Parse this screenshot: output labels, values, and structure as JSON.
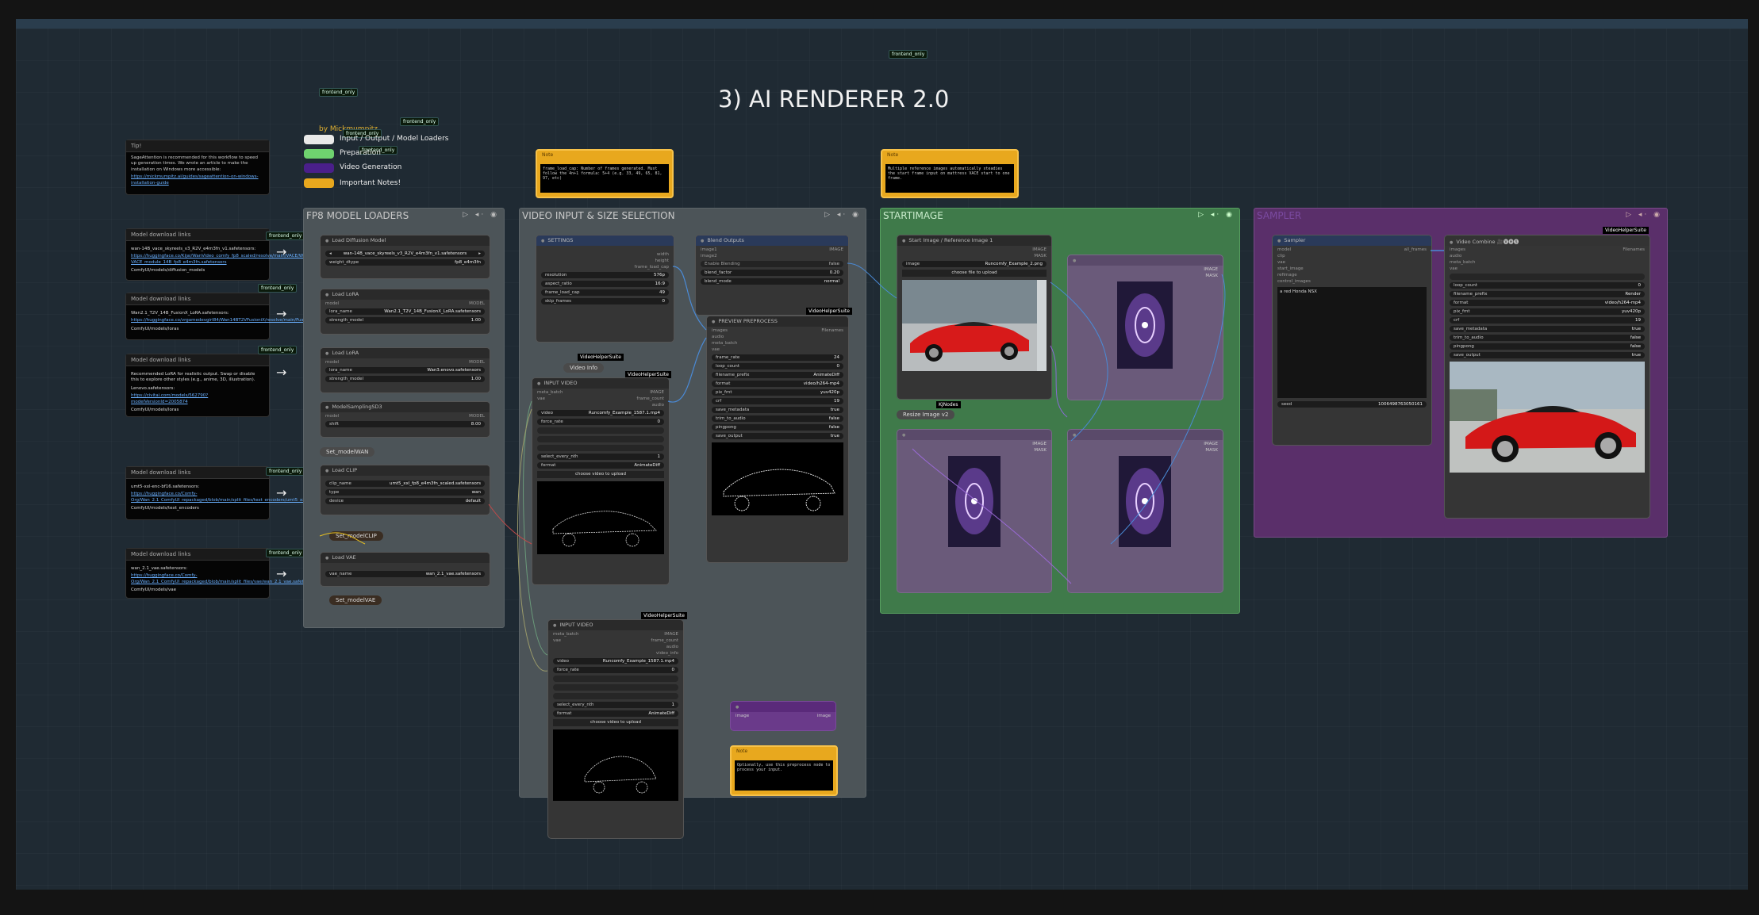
{
  "title": "3) AI RENDERER 2.0",
  "author": "by Mickmumpitz",
  "frontend_tag": "frontend_only",
  "legend": [
    {
      "label": "Input / Output / Model Loaders",
      "color": "#e9e9e9"
    },
    {
      "label": "Preparation",
      "color": "#6fd36f"
    },
    {
      "label": "Video Generation",
      "color": "#4a1f8a"
    },
    {
      "label": "Important Notes!",
      "color": "#e8a81e"
    }
  ],
  "tips": {
    "title": "Tip!",
    "body": "SageAttention is recommended for this workflow to speed up generation times. We wrote an article to make the installation on Windows more accessible:",
    "link": "https://mickmumpitz.ai/guides/sageattention-on-windows-installation-guide"
  },
  "downloads": [
    {
      "title": "Model download links",
      "name": "wan-14B_vace_skyreels_v3_R2V_e4m3fn_v1.safetensors:",
      "link": "https://huggingface.co/Kijai/WanVideo_comfy_fp8_scaled/resolve/main/VACE/Wan2_1-VACE_module_14B_fp8_e4m3fn.safetensors",
      "path": "ComfyUI/models/diffusion_models"
    },
    {
      "title": "Model download links",
      "name": "Wan2.1_T2V_14B_FusionX_LoRA.safetensors:",
      "link": "https://huggingface.co/vrgamedevgirl84/Wan14BT2VFusioniX/resolve/main/FusionX_LoRa/Wan2.1_T2V_14B_FusionX_LoRA.safetensors",
      "path": "ComfyUI/models/loras"
    },
    {
      "title": "Model download links",
      "name": "Recommended LoRA for realistic output. Swap or disable this to explore other styles (e.g., anime, 3D, illustration).",
      "link": "https://civitai.com/models/562790?modelVersionId=2005874",
      "path": "ComfyUI/models/loras",
      "extra": "Lenovo.safetensors:"
    },
    {
      "title": "Model download links",
      "name": "umt5-xxl-enc-bf16.safetensors:",
      "link": "https://huggingface.co/Comfy-Org/Wan_2.1_ComfyUI_repackaged/blob/main/split_files/text_encoders/umt5_xxl_fp8_e4m3fn_scaled.safetensors",
      "path": "ComfyUI/models/text_encoders"
    },
    {
      "title": "Model download links",
      "name": "wan_2.1_vae.safetensors:",
      "link": "https://huggingface.co/Comfy-Org/Wan_2.1_ComfyUI_repackaged/blob/main/split_files/vae/wan_2.1_vae.safetensors",
      "path": "ComfyUI/models/vae"
    }
  ],
  "groups": {
    "fp8": "FP8 MODEL LOADERS",
    "video": "VIDEO INPUT & SIZE SELECTION",
    "start": "STARTIMAGE",
    "sampler": "SAMPLER"
  },
  "loaders": {
    "diffusion": {
      "title": "Load Diffusion Model",
      "model": "wan-14B_vace_skyreels_v3_R2V_e4m3fn_v1.safetensors",
      "dtype_label": "weight_dtype",
      "dtype": "fp8_e4m3fn"
    },
    "lora1": {
      "title": "Load LoRA",
      "name_label": "lora_name",
      "name": "Wan2.1_T2V_14B_FusionX_LoRA.safetensors",
      "strength_label": "strength_model",
      "strength": "1.00"
    },
    "lora2": {
      "title": "Load LoRA",
      "name_label": "lora_name",
      "name": "Wan3.enovo.safetensors",
      "strength_label": "strength_model",
      "strength": "1.00"
    },
    "sampling": {
      "title": "ModelSamplingSD3",
      "shift_label": "shift",
      "shift": "8.00"
    },
    "set_wan": "Set_modelWAN",
    "clip": {
      "title": "Load CLIP",
      "name_label": "clip_name",
      "name": "umt5_xxl_fp8_e4m3fn_scaled.safetensors",
      "type_label": "type",
      "type": "wan",
      "device_label": "device",
      "device": "default"
    },
    "set_clip": "Set_modelCLIP",
    "vae": {
      "title": "Load VAE",
      "name_label": "vae_name",
      "name": "wan_2.1_vae.safetensors"
    },
    "set_vae": "Set_modelVAE"
  },
  "settings": {
    "title": "SETTINGS",
    "rows": [
      [
        "resolution",
        "576p"
      ],
      [
        "aspect_ratio",
        "16:9"
      ],
      [
        "frame_load_cap",
        "49"
      ],
      [
        "skip_frames",
        "0"
      ]
    ]
  },
  "video_info": "Video Info",
  "vhs": "VideoHelperSuite",
  "input_video_1": {
    "title": "INPUT VIDEO",
    "video": "Runcomfy_Example_1587.1.mp4",
    "force_rate": "0",
    "select_every_nth": "1",
    "format": "AnimateDiff",
    "upload": "choose video to upload"
  },
  "input_video_2": {
    "title": "INPUT VIDEO",
    "video": "Runcomfy_Example_1587.1.mp4",
    "force_rate": "0",
    "select_every_nth": "1",
    "format": "AnimateDiff",
    "upload": "choose video to upload"
  },
  "blend": {
    "title": "Blend Outputs",
    "rows": [
      [
        "blend_factor",
        "0.20"
      ],
      [
        "blend_mode",
        "normal"
      ]
    ]
  },
  "preview": {
    "title": "PREVIEW PREPROCESS",
    "rows": [
      [
        "frame_rate",
        "24"
      ],
      [
        "loop_count",
        "0"
      ],
      [
        "filename_prefix",
        "AnimateDiff"
      ],
      [
        "format",
        "video/h264-mp4"
      ],
      [
        "pix_fmt",
        "yuv420p"
      ],
      [
        "crf",
        "19"
      ],
      [
        "save_metadata",
        "true"
      ],
      [
        "trim_to_audio",
        "false"
      ],
      [
        "pingpong",
        "false"
      ],
      [
        "save_output",
        "true"
      ]
    ]
  },
  "notes": {
    "note1": {
      "title": "Note",
      "body": "frame_load_cap: Number of frames generated. Must follow the 4n+1 formula: 5+4 (e.g. 33, 49, 65, 81, 97, etc)"
    },
    "note2": {
      "title": "Note",
      "body": "Multiple reference images automatically steadies the start frame input on mattress VACE start to one frame."
    },
    "note3": {
      "title": "Note",
      "body": "Optionally, use this preprocess node to process your input."
    }
  },
  "start_image": {
    "title": "Start Image / Reference Image 1",
    "image": "Runcomfy_Example_2.png",
    "upload": "choose file to upload",
    "resize": "Resize Image v2",
    "kjnodes": "KJNodes"
  },
  "sampler_node": {
    "title": "Sampler",
    "inputs": [
      "model",
      "clip",
      "vae",
      "start_image",
      "refimage",
      "control_images"
    ],
    "output": "all_frames",
    "prompt": "a red Honda NSX",
    "seed_label": "seed",
    "seed": "1006498763050161"
  },
  "video_combine": {
    "title": "Video Combine 🎥🅥🅗🅢",
    "rows": [
      [
        "loop_count",
        "0"
      ],
      [
        "filename_prefix",
        "Render"
      ],
      [
        "format",
        "video/h264-mp4"
      ],
      [
        "pix_fmt",
        "yuv420p"
      ],
      [
        "crf",
        "19"
      ],
      [
        "save_metadata",
        "true"
      ],
      [
        "trim_to_audio",
        "false"
      ],
      [
        "pingpong",
        "false"
      ],
      [
        "save_output",
        "true"
      ]
    ]
  }
}
